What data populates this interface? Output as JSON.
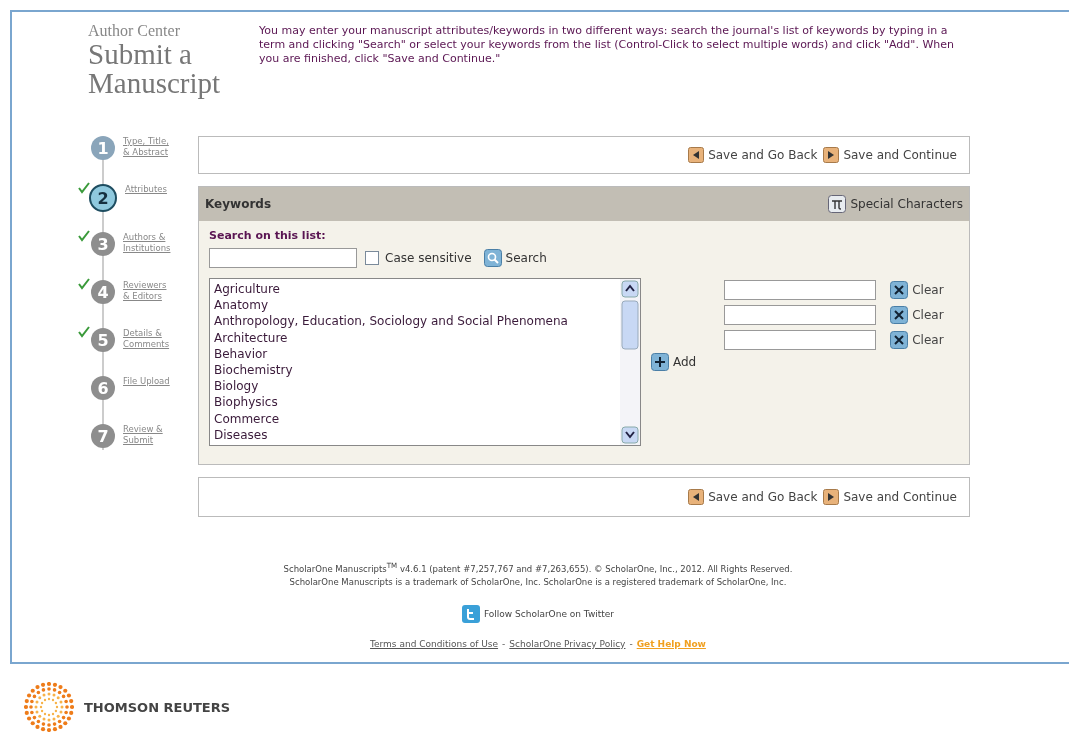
{
  "header": {
    "section": "Author Center",
    "title": "Submit a Manuscript",
    "instructions": "You may enter your manuscript attributes/keywords in two different ways: search the journal's list of keywords by typing in a term and clicking \"Search\" or select your keywords from the list (Control-Click to select multiple words) and click \"Add\". When you are finished, click \"Save and Continue.\""
  },
  "steps": [
    {
      "number": "1",
      "label": "Type, Title, & Abstract",
      "checked": false,
      "selected": false,
      "done": true
    },
    {
      "number": "2",
      "label": "Attributes",
      "checked": true,
      "selected": true,
      "done": true
    },
    {
      "number": "3",
      "label": "Authors & Institutions",
      "checked": true,
      "selected": false,
      "done": false
    },
    {
      "number": "4",
      "label": "Reviewers & Editors",
      "checked": true,
      "selected": false,
      "done": false
    },
    {
      "number": "5",
      "label": "Details & Comments",
      "checked": true,
      "selected": false,
      "done": false
    },
    {
      "number": "6",
      "label": "File Upload",
      "checked": false,
      "selected": false,
      "done": false
    },
    {
      "number": "7",
      "label": "Review & Submit",
      "checked": false,
      "selected": false,
      "done": false
    }
  ],
  "top_actions": [
    "Save and Go Back",
    "Save and Continue"
  ],
  "keywords": {
    "title": "Keywords",
    "special": "Special Characters",
    "search_label": "Search on this list:",
    "case_sensitive": {
      "label": "Case sensitive",
      "checked": false
    },
    "search_button": "Search",
    "list": [
      "Agriculture",
      "Anatomy",
      "Anthropology, Education, Sociology and Social Phenomena",
      "Architecture",
      "Behavior",
      "Biochemistry",
      "Biology",
      "Biophysics",
      "Commerce",
      "Diseases"
    ],
    "add_button": "Add",
    "fields": [
      {
        "clear": "Clear"
      },
      {
        "clear": "Clear"
      },
      {
        "clear": "Clear"
      }
    ]
  },
  "bottom_actions": [
    "Save and Go Back",
    "Save and Continue"
  ],
  "footer": {
    "copyright": "ScholarOne Manuscripts$^{TM}$ v4.6.1 (patent #7,257,767 and #7,263,655). © ScholarOne, Inc., 2012. All Rights Reserved.",
    "trademark": "ScholarOne Manuscripts is a trademark of ScholarOne, Inc. ScholarOne is a registered trademark of ScholarOne, Inc.",
    "twitter": "Follow ScholarOne on Twitter",
    "links": [
      {
        "text": "Terms and Conditions of Use",
        "kind": "plain"
      },
      {
        "text": "ScholarOne Privacy Policy",
        "kind": "plain"
      },
      {
        "text": "Get Help Now",
        "kind": "help"
      }
    ],
    "separator": "-"
  },
  "brand": "THOMSON REUTERS"
}
